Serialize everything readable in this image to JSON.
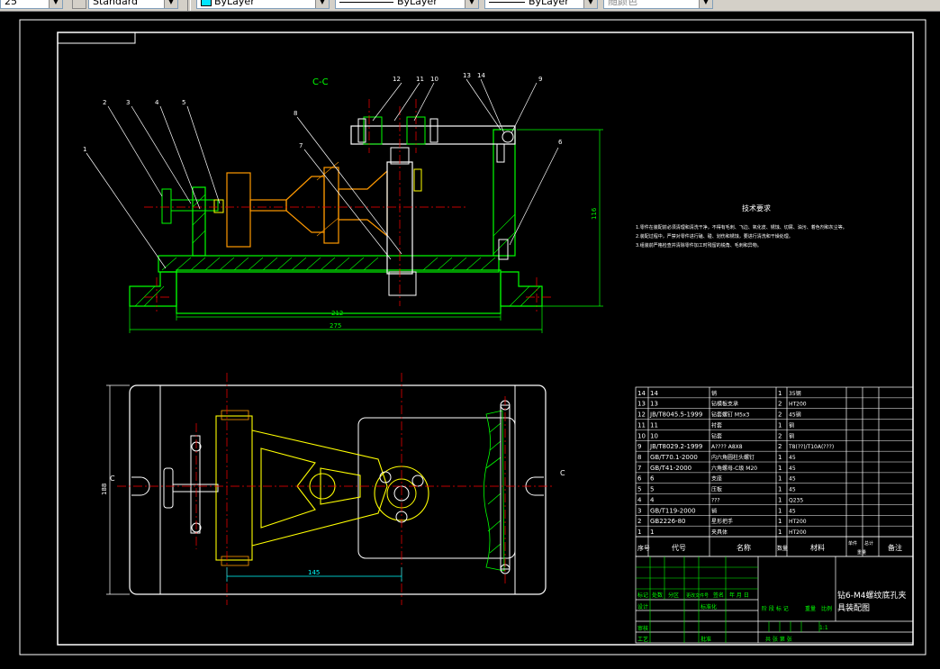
{
  "toolbar": {
    "dimstyle_value": "25",
    "textstyle_value": "Standard",
    "layer_color": "ByLayer",
    "linetype": "ByLayer",
    "lineweight": "ByLayer",
    "plotstyle": "随颜色"
  },
  "drawing": {
    "section_label": "C-C",
    "section_mark_left": "C",
    "section_mark_right": "C",
    "callouts": [
      "1",
      "2",
      "3",
      "4",
      "5",
      "6",
      "7",
      "8",
      "9",
      "10",
      "11",
      "12",
      "13",
      "14"
    ],
    "dims": {
      "height_116": "116",
      "width_212": "212",
      "width_275": "275",
      "plan_height_188": "188",
      "plan_width_145": "145"
    }
  },
  "tech_requirements": {
    "title": "技术要求",
    "lines": [
      "1.零件在装配前必须清理和清洗干净，不得有毛刺、飞边、氧化皮、锈蚀、切屑、油污、着色剂和灰尘等。",
      "2.装配过程中，严禁对零件进行磕、碰、划伤和锈蚀，要进行清洗和干燥处理。",
      "3.组装前严格检查并清除零件加工时残留的锐角、毛刺和异物。"
    ]
  },
  "parts_table": {
    "rows": [
      {
        "no": "14",
        "code": "14",
        "name": "销",
        "qty": "1",
        "material": "35钢"
      },
      {
        "no": "13",
        "code": "13",
        "name": "钻模板支承",
        "qty": "2",
        "material": "HT200"
      },
      {
        "no": "12",
        "code": "JB/T8045.5-1999",
        "name": "钻套螺钉 M5x3",
        "qty": "2",
        "material": "45钢"
      },
      {
        "no": "11",
        "code": "11",
        "name": "衬套",
        "qty": "1",
        "material": "钢"
      },
      {
        "no": "10",
        "code": "10",
        "name": "钻套",
        "qty": "2",
        "material": "钢"
      },
      {
        "no": "9",
        "code": "JB/T8029.2-1999",
        "name": "A???? A8X8",
        "qty": "2",
        "material": "T8(??)/T10A(???)"
      },
      {
        "no": "8",
        "code": "GB/T70.1-2000",
        "name": "内六角圆柱头螺钉",
        "qty": "1",
        "material": "45"
      },
      {
        "no": "7",
        "code": "GB/T41-2000",
        "name": "六角螺母-C级 M20",
        "qty": "1",
        "material": "45"
      },
      {
        "no": "6",
        "code": "6",
        "name": "支座",
        "qty": "1",
        "material": "45"
      },
      {
        "no": "5",
        "code": "5",
        "name": "压板",
        "qty": "1",
        "material": "45"
      },
      {
        "no": "4",
        "code": "4",
        "name": "???",
        "qty": "1",
        "material": "Q235"
      },
      {
        "no": "3",
        "code": "GB/T119-2000",
        "name": "销",
        "qty": "1",
        "material": "45"
      },
      {
        "no": "2",
        "code": "GB2226-80",
        "name": "星形把手",
        "qty": "1",
        "material": "HT200"
      },
      {
        "no": "1",
        "code": "1",
        "name": "夹具体",
        "qty": "1",
        "material": "HT200"
      }
    ],
    "header": {
      "no": "序号",
      "code": "代号",
      "name": "名称",
      "qty": "数量",
      "material": "材料",
      "single_weight": "单件",
      "total_weight": "总计",
      "weight": "重量",
      "remark": "备注"
    }
  },
  "title_block": {
    "drawing_title_line1": "钻6-M4螺纹底孔夹",
    "drawing_title_line2": "具装配图",
    "mark_col": "标记",
    "count_col": "处数",
    "zone_col": "分区",
    "change_doc": "更改文件号",
    "sign_col": "签名",
    "date_col": "年 月 日",
    "design": "设计",
    "standardize": "标准化",
    "review": "审核",
    "process": "工艺",
    "approve": "批准",
    "stage_mark": "阶 段 标 记",
    "weight": "重量",
    "scale": "比例",
    "scale_value": "1:1",
    "sheets": "共    张  第    张"
  },
  "colors": {
    "frame": "#ffffff",
    "yellow": "#ffff00",
    "orange": "#ff9900",
    "green": "#00ff00",
    "cyan": "#00ffff",
    "red": "#ff0000"
  }
}
